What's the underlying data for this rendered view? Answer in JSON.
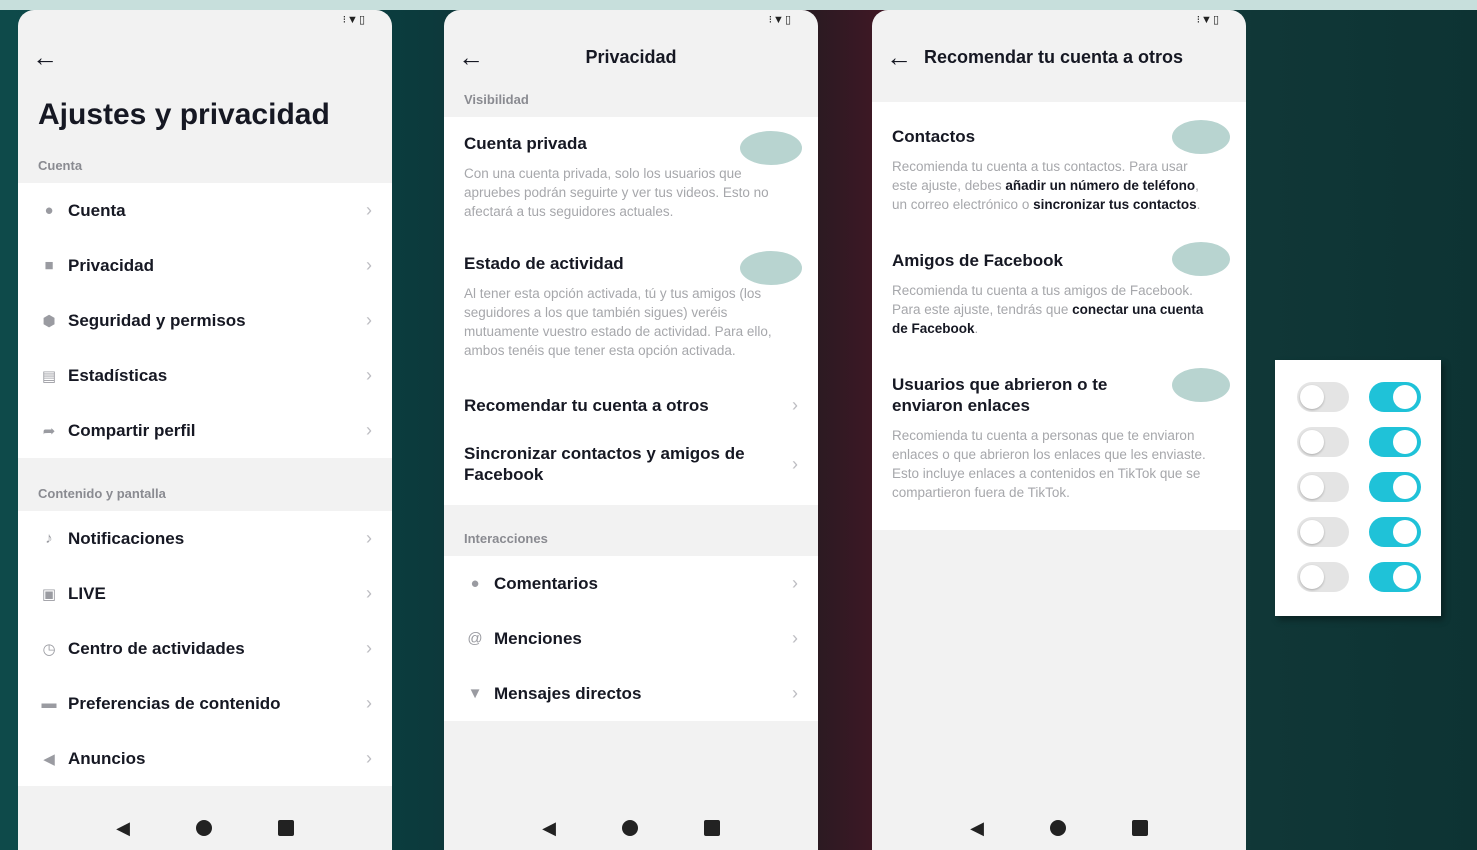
{
  "status_icons": "⁝▼▯",
  "screen1": {
    "title": "Ajustes y privacidad",
    "section_account": "Cuenta",
    "account_items": [
      {
        "icon": "person-icon",
        "label": "Cuenta"
      },
      {
        "icon": "lock-icon",
        "label": "Privacidad"
      },
      {
        "icon": "shield-icon",
        "label": "Seguridad y permisos"
      },
      {
        "icon": "chart-icon",
        "label": "Estadísticas"
      },
      {
        "icon": "share-icon",
        "label": "Compartir perfil"
      }
    ],
    "section_content": "Contenido y pantalla",
    "content_items": [
      {
        "icon": "bell-icon",
        "label": "Notificaciones"
      },
      {
        "icon": "tv-icon",
        "label": "LIVE"
      },
      {
        "icon": "clock-icon",
        "label": "Centro de actividades"
      },
      {
        "icon": "video-icon",
        "label": "Preferencias de contenido"
      },
      {
        "icon": "megaphone-icon",
        "label": "Anuncios"
      }
    ]
  },
  "screen2": {
    "title": "Privacidad",
    "section_visibility": "Visibilidad",
    "private_title": "Cuenta privada",
    "private_desc": "Con una cuenta privada, solo los usuarios que apruebes podrán seguirte y ver tus videos. Esto no afectará a tus seguidores actuales.",
    "activity_title": "Estado de actividad",
    "activity_desc": "Al tener esta opción activada, tú y tus amigos (los seguidores a los que también sigues) veréis mutuamente vuestro estado de actividad. Para ello, ambos tenéis que tener esta opción activada.",
    "recommend_label": "Recomendar tu cuenta a otros",
    "sync_label": "Sincronizar contactos y amigos de Facebook",
    "section_interactions": "Interacciones",
    "interaction_items": [
      {
        "icon": "comment-icon",
        "label": "Comentarios"
      },
      {
        "icon": "at-icon",
        "label": "Menciones"
      },
      {
        "icon": "send-icon",
        "label": "Mensajes directos"
      }
    ]
  },
  "screen3": {
    "title": "Recomendar tu cuenta a otros",
    "contacts_title": "Contactos",
    "contacts_desc_1": "Recomienda tu cuenta a tus contactos. Para usar este ajuste, debes ",
    "contacts_desc_b1": "añadir un número de teléfono",
    "contacts_desc_2": ", un correo electrónico o ",
    "contacts_desc_b2": "sincronizar tus contactos",
    "contacts_desc_3": ".",
    "facebook_title": "Amigos de Facebook",
    "facebook_desc_1": "Recomienda tu cuenta a tus amigos de Facebook. Para este ajuste, tendrás que ",
    "facebook_desc_b1": "conectar una cuenta de Facebook",
    "facebook_desc_2": ".",
    "links_title": "Usuarios que abrieron o te enviaron enlaces",
    "links_desc": "Recomienda tu cuenta a personas que te enviaron enlaces o que abrieron los enlaces que les enviaste. Esto incluye enlaces a contenidos en TikTok que se compartieron fuera de TikTok."
  },
  "colors": {
    "toggle_on": "#1fc2d8",
    "toggle_off": "#e4e4e4",
    "toggle_placeholder": "#b8d4d0"
  }
}
